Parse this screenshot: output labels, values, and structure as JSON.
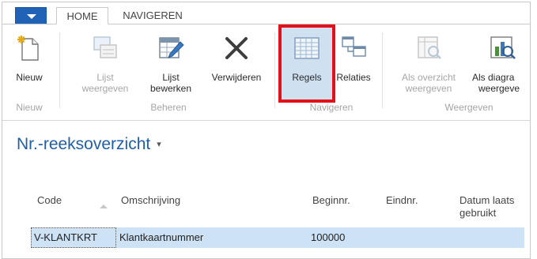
{
  "tabs": {
    "home": "HOME",
    "navigate": "NAVIGEREN"
  },
  "ribbon": {
    "new": "Nieuw",
    "list_view": [
      "Lijst",
      "weergeven"
    ],
    "list_edit": [
      "Lijst",
      "bewerken"
    ],
    "delete": "Verwijderen",
    "lines": "Regels",
    "relations": "Relaties",
    "as_overview": [
      "Als overzicht",
      "weergeven"
    ],
    "as_chart": [
      "Als diagra",
      "weergeve"
    ],
    "groups": {
      "new": "Nieuw",
      "manage": "Beheren",
      "navigate": "Navigeren",
      "view": "Weergeven"
    }
  },
  "page": {
    "title": "Nr.-reeksoverzicht",
    "title_dropdown": "▾"
  },
  "table": {
    "headers": {
      "code": "Code",
      "description": "Omschrijving",
      "start": "Beginnr.",
      "end": "Eindnr.",
      "last_used": [
        "Datum laats",
        "gebruikt"
      ]
    },
    "rows": [
      {
        "code": "V-KLANTKRT",
        "description": "Klantkaartnummer",
        "start": "100000",
        "end": "",
        "last_used": ""
      }
    ]
  },
  "colors": {
    "accent": "#1f62b6",
    "title": "#1f5fa8",
    "highlight": "#e3101a",
    "selected_row": "#cde3f5"
  },
  "icons": [
    "app-menu-caret-icon",
    "new-document-icon",
    "list-view-icon",
    "list-edit-icon",
    "delete-x-icon",
    "lines-grid-icon",
    "relations-icon",
    "overview-icon",
    "chart-icon",
    "sort-ascending-icon"
  ]
}
